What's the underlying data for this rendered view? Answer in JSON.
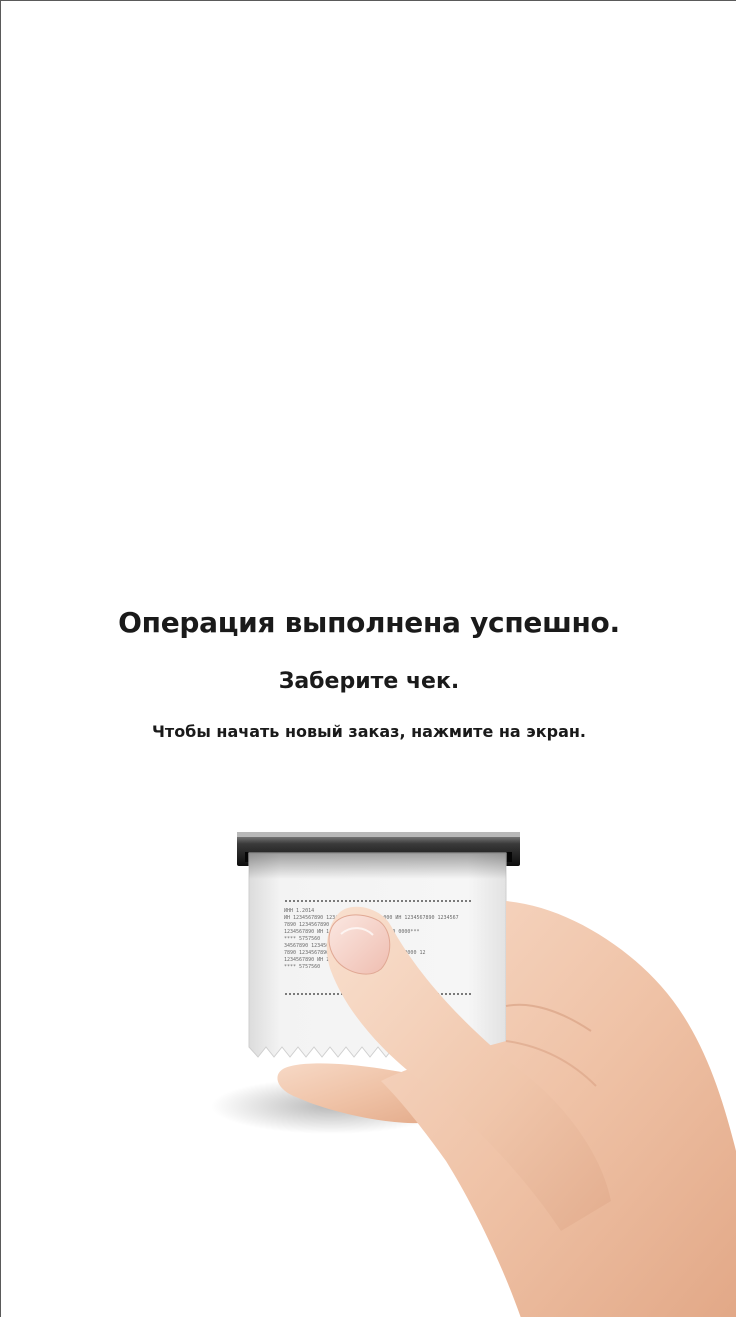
{
  "screen": {
    "title": "Операция выполнена успешно.",
    "subtitle": "Заберите чек.",
    "hint": "Чтобы начать новый заказ, нажмите на экран."
  },
  "illustration": {
    "icon": "hand-taking-receipt-icon",
    "receipt_lines": [
      "ИНН 1.2014",
      "ИН 1234567890 12345670 0000 0000 000 ИН 1234567890 1234567",
      "7890 1234567890",
      "1234567890 ИН 1234567890 0000 0000000 0000***",
      "**** 5757560",
      "34567890 1234567890 1234567890 1234567",
      "7890 1234567890 1234567890 1234 1234567 0000 12",
      "1234567890 ИН 1234567890 0000000 0000***",
      "**** 5757560"
    ]
  }
}
